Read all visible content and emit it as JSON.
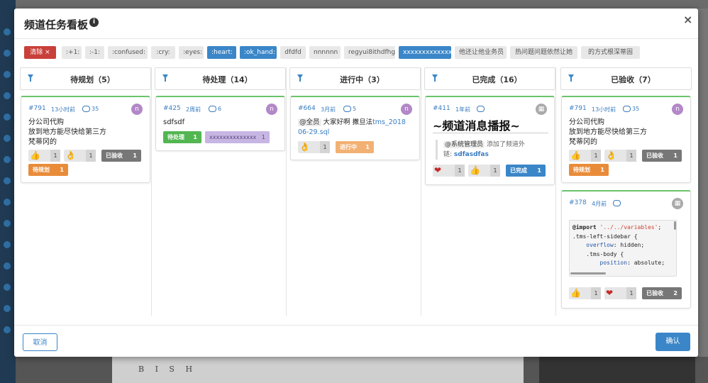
{
  "modal": {
    "title": "频道任务看板",
    "cancel_label": "取消",
    "ok_label": "确认"
  },
  "tags": [
    {
      "label": "清除 ×",
      "type": "clear"
    },
    {
      "label": ":+1:",
      "type": "normal"
    },
    {
      "label": ":-1:",
      "type": "normal"
    },
    {
      "label": ":confused:",
      "type": "normal"
    },
    {
      "label": ":cry:",
      "type": "normal"
    },
    {
      "label": ":eyes:",
      "type": "normal"
    },
    {
      "label": ":heart:",
      "type": "selected"
    },
    {
      "label": ":ok_hand:",
      "type": "selected"
    },
    {
      "label": "dfdfd",
      "type": "normal"
    },
    {
      "label": "nnnnnn",
      "type": "normal"
    },
    {
      "label": "regyui8ithdfhg",
      "type": "normal"
    },
    {
      "label": "xxxxxxxxxxxxxx",
      "type": "selected"
    },
    {
      "label": "他还让他业务员",
      "type": "normal"
    },
    {
      "label": "热问题问题依然让她",
      "type": "normal"
    },
    {
      "label": "的方式根深蒂固",
      "type": "normal"
    }
  ],
  "columns": [
    {
      "title": "待规划（5）"
    },
    {
      "title": "待处理（14）"
    },
    {
      "title": "进行中（3）"
    },
    {
      "title": "已完成（16）"
    },
    {
      "title": "已验收（7）"
    }
  ],
  "cards": {
    "c1": {
      "id": "#791",
      "time": "13小时前",
      "comments": "35",
      "lines": [
        "分公司代购",
        "放到地方能尽快给第三方",
        "梵蒂冈的"
      ],
      "r1": "1",
      "r2": "1",
      "status": "已验收",
      "status_count": "1",
      "status2": "待规划",
      "status2_count": "1"
    },
    "c2": {
      "id": "#425",
      "time": "2周前",
      "comments": "6",
      "text": "sdfsdf",
      "status": "待处理",
      "status_count": "1",
      "tag": "xxxxxxxxxxxxxx",
      "tag_count": "1"
    },
    "c3": {
      "id": "#664",
      "time": "3月前",
      "comments": "5",
      "mention": "@全员",
      "text": "大家好啊 撒旦法",
      "link_part1": "tms_2018",
      "link_part2": "06-29.sql",
      "r1": "1",
      "status": "进行中",
      "status_count": "1"
    },
    "c4": {
      "id": "#411",
      "time": "1年前",
      "comments": "",
      "big_title": "~频道消息播报~",
      "mention": "@系统管理员",
      "quote_text": "添加了频道外",
      "quote_label": "链:",
      "quote_link": "sdfasdfas",
      "r1": "1",
      "r2": "1",
      "status": "已完成",
      "status_count": "1"
    },
    "c5": {
      "id": "#791",
      "time": "13小时前",
      "comments": "35",
      "lines": [
        "分公司代购",
        "放到地方能尽快给第三方",
        "梵蒂冈的"
      ],
      "r1": "1",
      "r2": "1",
      "status": "已验收",
      "status_count": "1",
      "status2": "待规划",
      "status2_count": "1"
    },
    "c6": {
      "id": "#378",
      "time": "4月前",
      "comments": "",
      "code": {
        "l1_kw": "@import",
        "l1_str": " '../../variables'",
        "l1_end": ";",
        "l2": ".tms-left-sidebar {",
        "l3_prop": "    overflow",
        "l3_val": ": hidden;",
        "l4": "    .tms-body {",
        "l5_prop": "        position",
        "l5_val": ": absolute;"
      },
      "r1": "1",
      "r2": "1",
      "status": "已验收",
      "status_count": "2"
    }
  },
  "emoji": {
    "thumbs": "👍",
    "ok": "👌",
    "heart": "❤"
  },
  "icons": {
    "info": "info-icon",
    "close": "close-icon",
    "filter": "filter-icon",
    "comment": "comment-icon"
  },
  "colors": {
    "primary": "#3a86c8",
    "clear": "#c9403a",
    "card_border": "#6ac36b"
  }
}
